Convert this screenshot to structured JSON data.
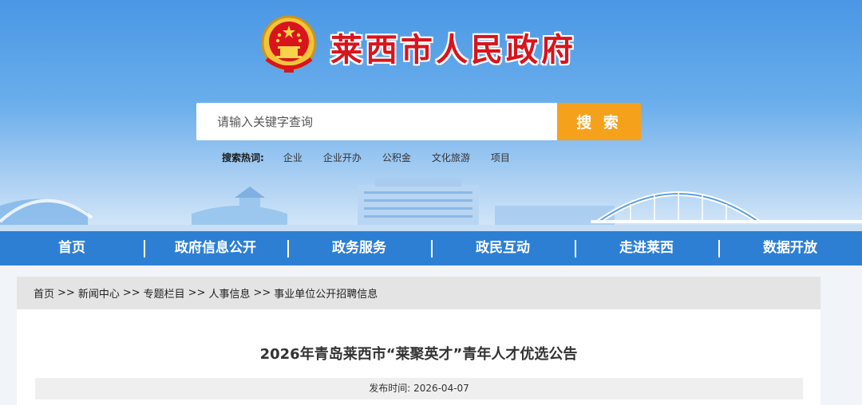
{
  "site": {
    "title": "莱西市人民政府"
  },
  "search": {
    "placeholder": "请输入关键字查询",
    "button_label": "搜 索"
  },
  "hot_search": {
    "label": "搜索热词:",
    "items": [
      "企业",
      "企业开办",
      "公积金",
      "文化旅游",
      "项目"
    ]
  },
  "nav": {
    "items": [
      "首页",
      "政府信息公开",
      "政务服务",
      "政民互动",
      "走进莱西",
      "数据开放"
    ]
  },
  "breadcrumb": {
    "items": [
      "首页",
      "新闻中心",
      "专题栏目",
      "人事信息",
      "事业单位公开招聘信息"
    ],
    "separator": ">>"
  },
  "article": {
    "title": "2026年青岛莱西市“莱聚英才”青年人才优选公告",
    "publish_label": "发布时间:",
    "publish_date": "2026-04-07"
  },
  "colors": {
    "accent_red": "#d8141c",
    "nav_blue": "#2d7fd4",
    "search_orange": "#f5a11c"
  }
}
